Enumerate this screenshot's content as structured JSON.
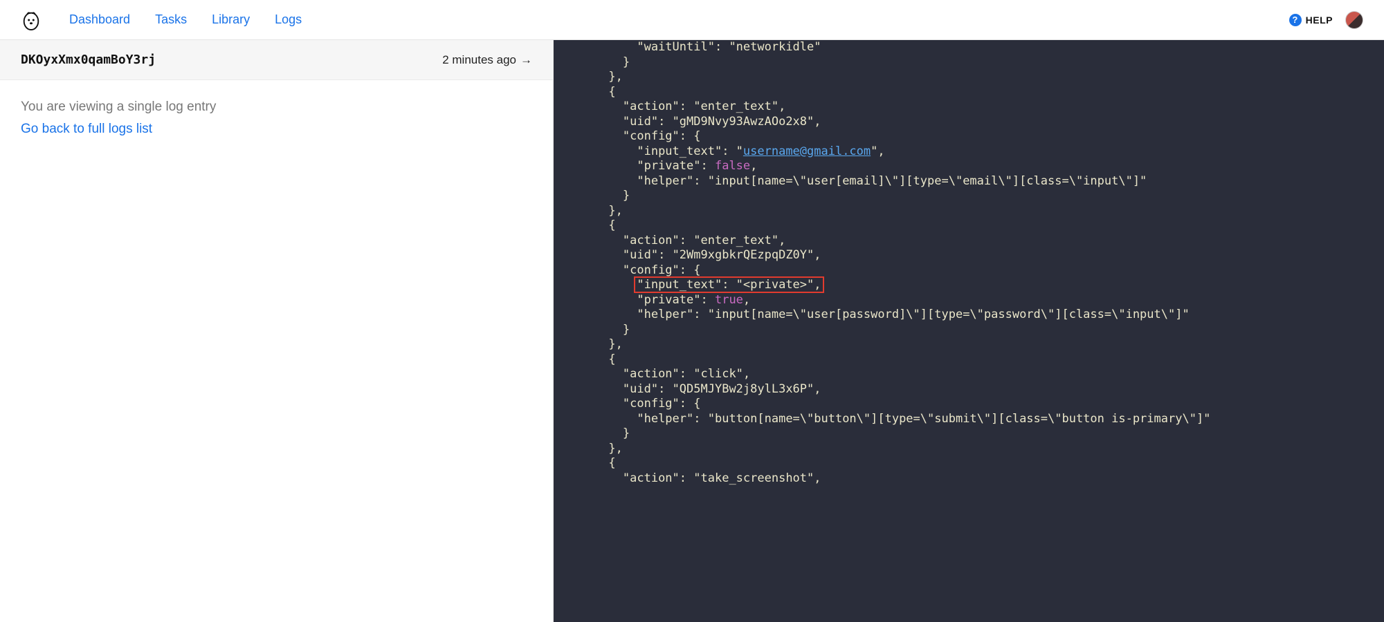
{
  "nav": {
    "dashboard": "Dashboard",
    "tasks": "Tasks",
    "library": "Library",
    "logs": "Logs",
    "help": "HELP"
  },
  "entry": {
    "id": "DKOyxXmx0qamBoY3rj",
    "time": "2 minutes ago",
    "arrow": "→",
    "viewing_msg": "You are viewing a single log entry",
    "back_link": "Go back to full logs list"
  },
  "code": {
    "lines": [
      {
        "indent": 5,
        "segs": [
          {
            "t": "key",
            "v": "\"waitUntil\""
          },
          {
            "t": "pun",
            "v": ": "
          },
          {
            "t": "str",
            "v": "\"networkidle\""
          }
        ]
      },
      {
        "indent": 4,
        "segs": [
          {
            "t": "pun",
            "v": "}"
          }
        ]
      },
      {
        "indent": 3,
        "segs": [
          {
            "t": "pun",
            "v": "},"
          }
        ]
      },
      {
        "indent": 3,
        "segs": [
          {
            "t": "pun",
            "v": "{"
          }
        ]
      },
      {
        "indent": 4,
        "segs": [
          {
            "t": "key",
            "v": "\"action\""
          },
          {
            "t": "pun",
            "v": ": "
          },
          {
            "t": "str",
            "v": "\"enter_text\""
          },
          {
            "t": "pun",
            "v": ","
          }
        ]
      },
      {
        "indent": 4,
        "segs": [
          {
            "t": "key",
            "v": "\"uid\""
          },
          {
            "t": "pun",
            "v": ": "
          },
          {
            "t": "str",
            "v": "\"gMD9Nvy93AwzAOo2x8\""
          },
          {
            "t": "pun",
            "v": ","
          }
        ]
      },
      {
        "indent": 4,
        "segs": [
          {
            "t": "key",
            "v": "\"config\""
          },
          {
            "t": "pun",
            "v": ": {"
          }
        ]
      },
      {
        "indent": 5,
        "segs": [
          {
            "t": "key",
            "v": "\"input_text\""
          },
          {
            "t": "pun",
            "v": ": \""
          },
          {
            "t": "email",
            "v": "username@gmail.com"
          },
          {
            "t": "pun",
            "v": "\","
          }
        ]
      },
      {
        "indent": 5,
        "segs": [
          {
            "t": "key",
            "v": "\"private\""
          },
          {
            "t": "pun",
            "v": ": "
          },
          {
            "t": "false",
            "v": "false"
          },
          {
            "t": "pun",
            "v": ","
          }
        ]
      },
      {
        "indent": 5,
        "segs": [
          {
            "t": "key",
            "v": "\"helper\""
          },
          {
            "t": "pun",
            "v": ": "
          },
          {
            "t": "str",
            "v": "\"input[name=\\\"user[email]\\\"][type=\\\"email\\\"][class=\\\"input\\\"]\""
          }
        ]
      },
      {
        "indent": 4,
        "segs": [
          {
            "t": "pun",
            "v": "}"
          }
        ]
      },
      {
        "indent": 3,
        "segs": [
          {
            "t": "pun",
            "v": "},"
          }
        ]
      },
      {
        "indent": 3,
        "segs": [
          {
            "t": "pun",
            "v": "{"
          }
        ]
      },
      {
        "indent": 4,
        "segs": [
          {
            "t": "key",
            "v": "\"action\""
          },
          {
            "t": "pun",
            "v": ": "
          },
          {
            "t": "str",
            "v": "\"enter_text\""
          },
          {
            "t": "pun",
            "v": ","
          }
        ]
      },
      {
        "indent": 4,
        "segs": [
          {
            "t": "key",
            "v": "\"uid\""
          },
          {
            "t": "pun",
            "v": ": "
          },
          {
            "t": "str",
            "v": "\"2Wm9xgbkrQEzpqDZ0Y\""
          },
          {
            "t": "pun",
            "v": ","
          }
        ]
      },
      {
        "indent": 4,
        "segs": [
          {
            "t": "key",
            "v": "\"config\""
          },
          {
            "t": "pun",
            "v": ": {"
          }
        ]
      },
      {
        "indent": 5,
        "hl": true,
        "segs": [
          {
            "t": "key",
            "v": "\"input_text\""
          },
          {
            "t": "pun",
            "v": ": "
          },
          {
            "t": "str",
            "v": "\"<private>\""
          },
          {
            "t": "pun",
            "v": ","
          }
        ]
      },
      {
        "indent": 5,
        "segs": [
          {
            "t": "key",
            "v": "\"private\""
          },
          {
            "t": "pun",
            "v": ": "
          },
          {
            "t": "true",
            "v": "true"
          },
          {
            "t": "pun",
            "v": ","
          }
        ]
      },
      {
        "indent": 5,
        "segs": [
          {
            "t": "key",
            "v": "\"helper\""
          },
          {
            "t": "pun",
            "v": ": "
          },
          {
            "t": "str",
            "v": "\"input[name=\\\"user[password]\\\"][type=\\\"password\\\"][class=\\\"input\\\"]\""
          }
        ]
      },
      {
        "indent": 4,
        "segs": [
          {
            "t": "pun",
            "v": "}"
          }
        ]
      },
      {
        "indent": 3,
        "segs": [
          {
            "t": "pun",
            "v": "},"
          }
        ]
      },
      {
        "indent": 3,
        "segs": [
          {
            "t": "pun",
            "v": "{"
          }
        ]
      },
      {
        "indent": 4,
        "segs": [
          {
            "t": "key",
            "v": "\"action\""
          },
          {
            "t": "pun",
            "v": ": "
          },
          {
            "t": "str",
            "v": "\"click\""
          },
          {
            "t": "pun",
            "v": ","
          }
        ]
      },
      {
        "indent": 4,
        "segs": [
          {
            "t": "key",
            "v": "\"uid\""
          },
          {
            "t": "pun",
            "v": ": "
          },
          {
            "t": "str",
            "v": "\"QD5MJYBw2j8ylL3x6P\""
          },
          {
            "t": "pun",
            "v": ","
          }
        ]
      },
      {
        "indent": 4,
        "segs": [
          {
            "t": "key",
            "v": "\"config\""
          },
          {
            "t": "pun",
            "v": ": {"
          }
        ]
      },
      {
        "indent": 5,
        "segs": [
          {
            "t": "key",
            "v": "\"helper\""
          },
          {
            "t": "pun",
            "v": ": "
          },
          {
            "t": "str",
            "v": "\"button[name=\\\"button\\\"][type=\\\"submit\\\"][class=\\\"button is-primary\\\"]\""
          }
        ]
      },
      {
        "indent": 4,
        "segs": [
          {
            "t": "pun",
            "v": "}"
          }
        ]
      },
      {
        "indent": 3,
        "segs": [
          {
            "t": "pun",
            "v": "},"
          }
        ]
      },
      {
        "indent": 3,
        "segs": [
          {
            "t": "pun",
            "v": "{"
          }
        ]
      },
      {
        "indent": 4,
        "segs": [
          {
            "t": "key",
            "v": "\"action\""
          },
          {
            "t": "pun",
            "v": ": "
          },
          {
            "t": "str",
            "v": "\"take_screenshot\""
          },
          {
            "t": "pun",
            "v": ","
          }
        ]
      }
    ],
    "indent_unit": "  "
  }
}
